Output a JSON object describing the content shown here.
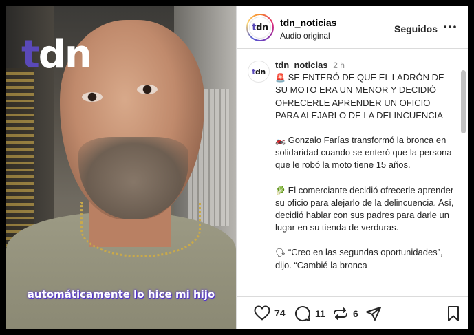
{
  "media": {
    "logo_t": "t",
    "logo_rest": "dn",
    "caption": "automáticamente lo hice mi hijo"
  },
  "header": {
    "avatar_t": "t",
    "avatar_rest": "dn",
    "username": "tdn_noticias",
    "subtitle": "Audio original",
    "follow_label": "Seguidos",
    "more_icon": "more-horizontal-icon"
  },
  "post": {
    "avatar_t": "t",
    "avatar_rest": "dn",
    "username": "tdn_noticias",
    "time": "2 h",
    "headline_emoji": "🚨",
    "headline": "SE ENTERÓ DE QUE EL LADRÓN DE SU MOTO ERA UN MENOR Y DECIDIÓ OFRECERLE APRENDER UN OFICIO PARA ALEJARLO DE LA DELINCUENCIA",
    "p1_emoji": "🏍️",
    "p1": "Gonzalo Farías transformó la bronca en solidaridad cuando se enteró que la persona que le robó la moto tiene 15 años.",
    "p2_emoji": "🥬",
    "p2": "El comerciante decidió ofrecerle aprender su oficio para alejarlo de la delincuencia. Así, decidió hablar con sus padres para darle un lugar en su tienda de verduras.",
    "p3_emoji": "🗣",
    "p3": "“Creo en las segundas oportunidades”, dijo. “Cambié la bronca"
  },
  "actions": {
    "like_count": "74",
    "comment_count": "11",
    "repost_count": "6"
  }
}
